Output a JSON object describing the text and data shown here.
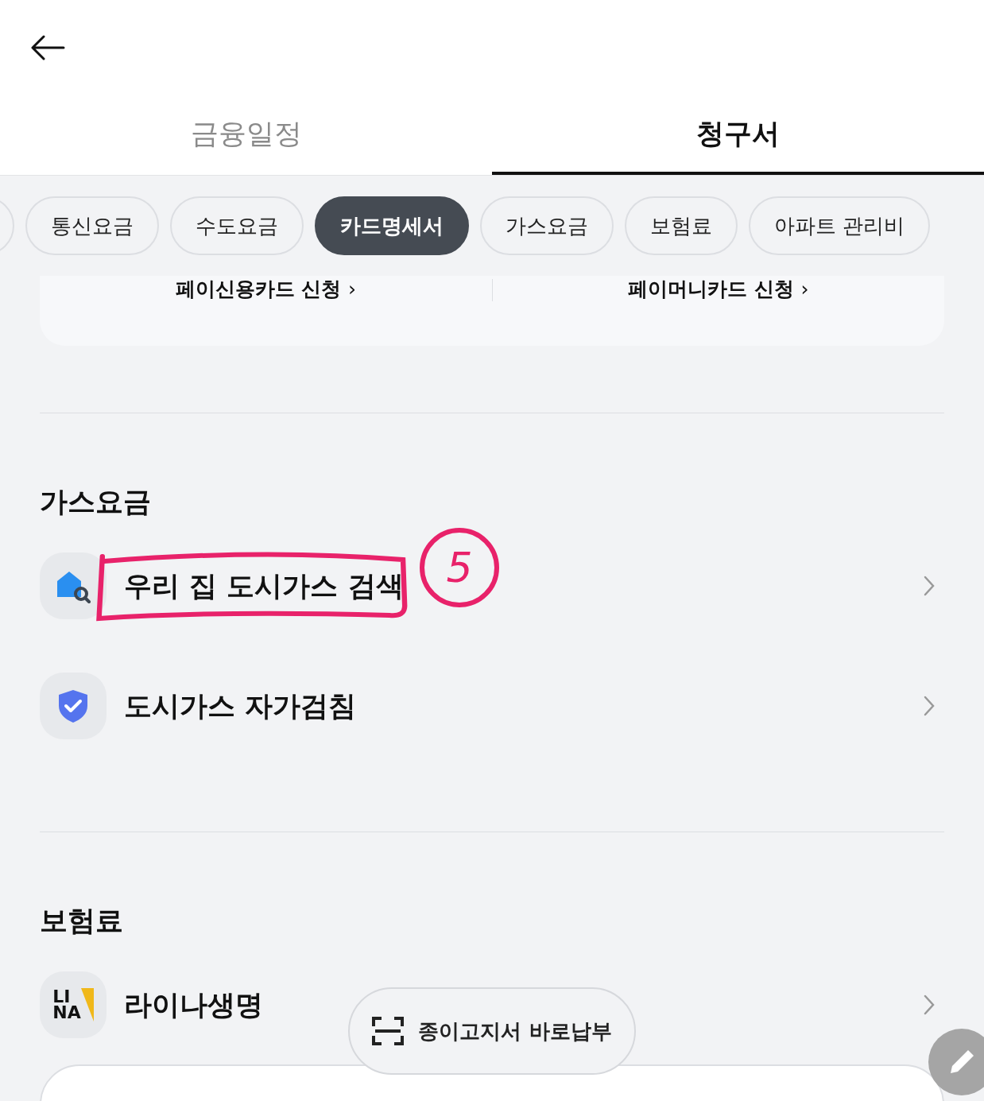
{
  "tabs": [
    {
      "label": "금융일정",
      "selected": false
    },
    {
      "label": "청구서",
      "selected": true
    }
  ],
  "chips": [
    {
      "label": "통신요금",
      "selected": false
    },
    {
      "label": "수도요금",
      "selected": false
    },
    {
      "label": "카드명세서",
      "selected": true
    },
    {
      "label": "가스요금",
      "selected": false
    },
    {
      "label": "보험료",
      "selected": false
    },
    {
      "label": "아파트 관리비",
      "selected": false
    }
  ],
  "card_links": [
    {
      "label": "페이신용카드 신청",
      "arrow": "›"
    },
    {
      "label": "페이머니카드 신청",
      "arrow": "›"
    }
  ],
  "sections": [
    {
      "title": "가스요금",
      "items": [
        {
          "label": "우리 집 도시가스 검색",
          "kind": "house",
          "annotated": true
        },
        {
          "label": "도시가스 자가검침",
          "kind": "shield",
          "annotated": false
        }
      ]
    },
    {
      "title": "보험료",
      "items": [
        {
          "label": "라이나생명",
          "kind": "logo",
          "logo_lines": [
            "LI",
            "NA"
          ],
          "annotated": false
        }
      ]
    }
  ],
  "annotation": {
    "label": "5"
  },
  "floating_button": {
    "label": "종이고지서 바로납부"
  }
}
